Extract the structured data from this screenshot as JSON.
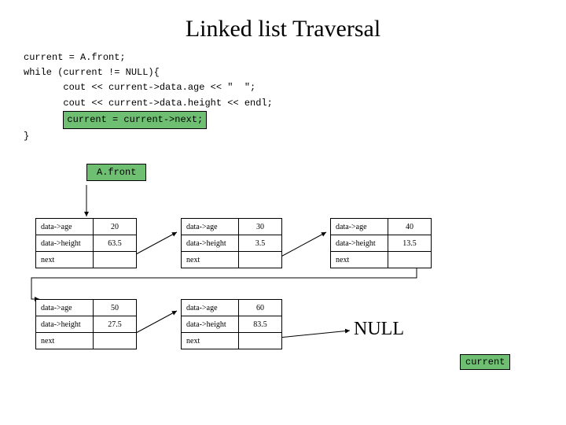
{
  "title": "Linked list Traversal",
  "code": {
    "l1": "current = A.front;",
    "l2": "while (current != NULL){",
    "l3": "       cout << current->data.age << \"  \";",
    "l4": "       cout << current->data.height << endl;",
    "l5": "current = current->next;",
    "l6": "}"
  },
  "front_label": "A.front",
  "field_age": "data->age",
  "field_height": "data->height",
  "field_next": "next",
  "nodes": [
    {
      "age": "20",
      "height": "63.5"
    },
    {
      "age": "30",
      "height": "3.5"
    },
    {
      "age": "40",
      "height": "13.5"
    },
    {
      "age": "50",
      "height": "27.5"
    },
    {
      "age": "60",
      "height": "83.5"
    }
  ],
  "null_label": "NULL",
  "current_label": "current"
}
